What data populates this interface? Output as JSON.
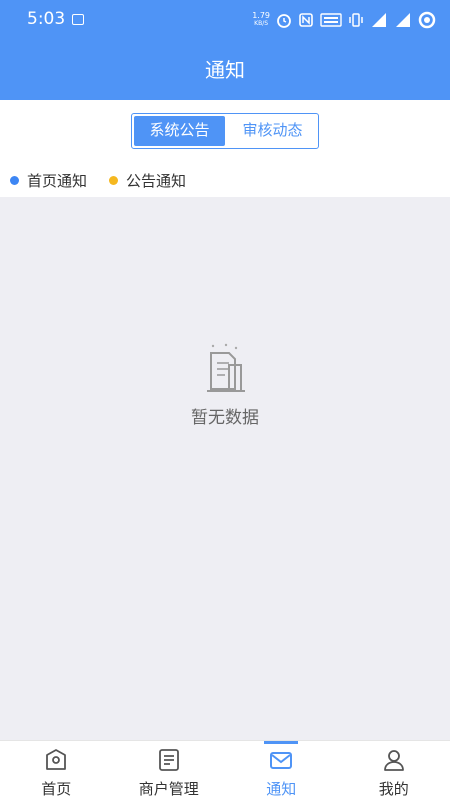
{
  "status_bar": {
    "time": "5:03",
    "speed_value": "1.79",
    "speed_unit": "KB/S",
    "icons": [
      "photo-icon",
      "alarm-icon",
      "nfc-icon",
      "volte-icon",
      "vibrate-icon",
      "signal-4g-icon",
      "signal-4g-icon",
      "battery-ring-icon"
    ]
  },
  "header": {
    "title": "通知"
  },
  "segment": {
    "tabs": [
      {
        "label": "系统公告",
        "active": true
      },
      {
        "label": "审核动态",
        "active": false
      }
    ]
  },
  "legend": {
    "items": [
      {
        "label": "首页通知",
        "color": "#3d86f4"
      },
      {
        "label": "公告通知",
        "color": "#f5b820"
      }
    ]
  },
  "empty_state": {
    "text": "暂无数据",
    "icon": "empty-document-icon"
  },
  "tabbar": {
    "items": [
      {
        "label": "首页",
        "icon": "home-icon",
        "active": false
      },
      {
        "label": "商户管理",
        "icon": "merchant-list-icon",
        "active": false
      },
      {
        "label": "通知",
        "icon": "mail-icon",
        "active": true
      },
      {
        "label": "我的",
        "icon": "user-icon",
        "active": false
      }
    ]
  },
  "colors": {
    "primary": "#4f94f6",
    "background": "#eeeef3"
  }
}
